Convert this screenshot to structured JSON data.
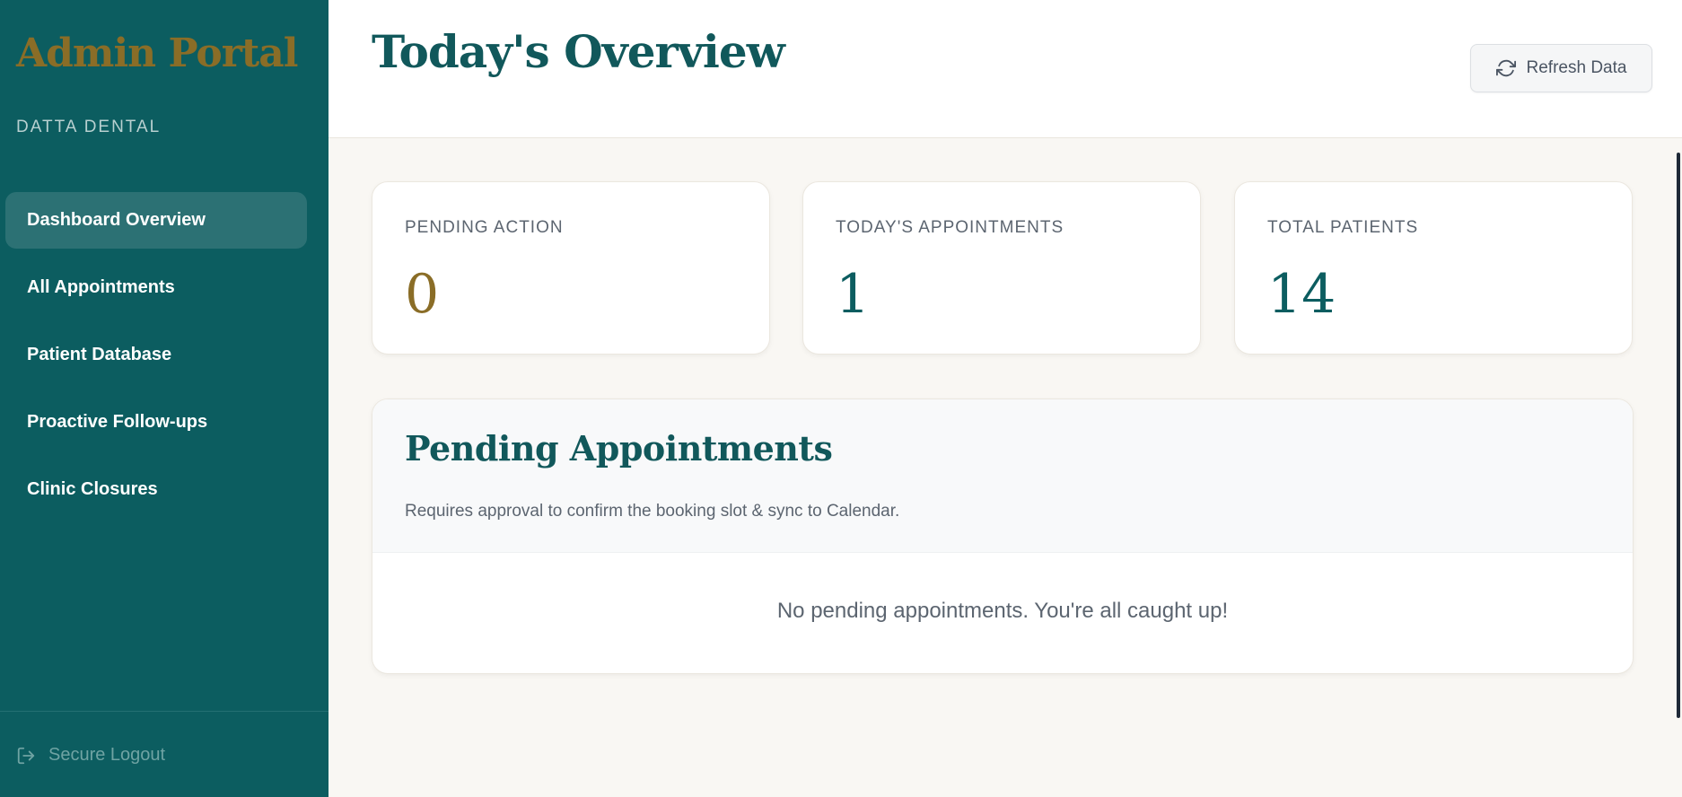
{
  "sidebar": {
    "brand": "Admin Portal",
    "clinic_name": "DATTA DENTAL",
    "items": [
      {
        "label": "Dashboard Overview"
      },
      {
        "label": "All Appointments"
      },
      {
        "label": "Patient Database"
      },
      {
        "label": "Proactive Follow-ups"
      },
      {
        "label": "Clinic Closures"
      }
    ],
    "active_index": 0,
    "logout_label": "Secure Logout"
  },
  "header": {
    "title": "Today's Overview",
    "refresh_label": "Refresh Data"
  },
  "stats": [
    {
      "label": "PENDING ACTION",
      "value": "0"
    },
    {
      "label": "TODAY'S APPOINTMENTS",
      "value": "1"
    },
    {
      "label": "TOTAL PATIENTS",
      "value": "14"
    }
  ],
  "pending_panel": {
    "title": "Pending Appointments",
    "subtitle": "Requires approval to confirm the booking slot & sync to Calendar.",
    "empty_message": "No pending appointments. You're all caught up!"
  },
  "colors": {
    "sidebar_bg": "#0c5d60",
    "accent_teal": "#11585b",
    "accent_gold": "#8a6d27",
    "page_bg": "#f9f7f3"
  },
  "icons": {
    "refresh": "refresh-icon",
    "logout": "logout-icon"
  }
}
